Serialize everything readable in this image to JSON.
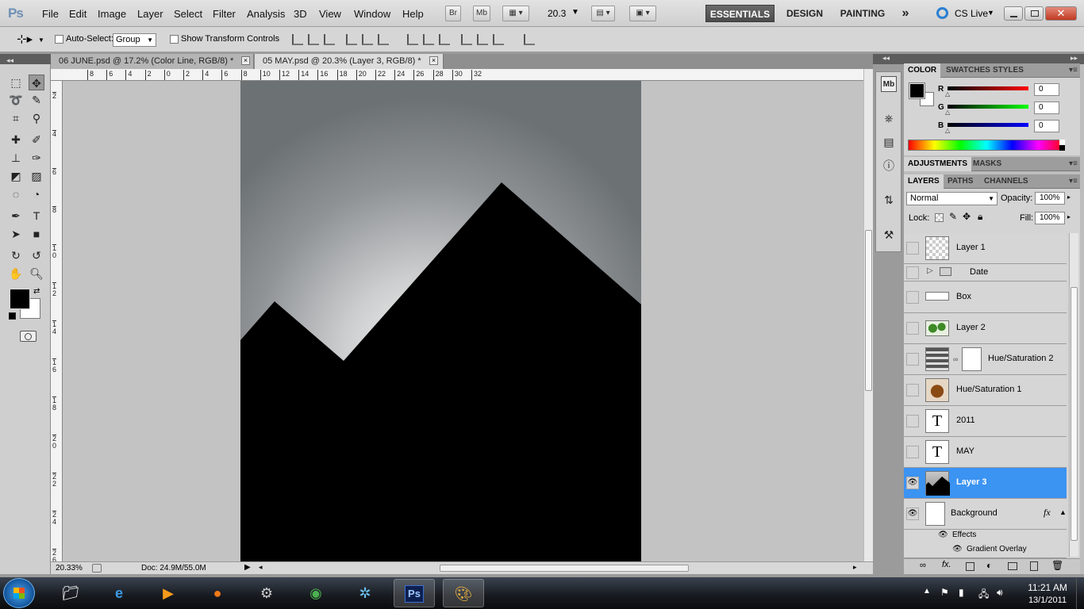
{
  "app": {
    "logo": "Ps"
  },
  "menu": [
    "File",
    "Edit",
    "Image",
    "Layer",
    "Select",
    "Filter",
    "Analysis",
    "3D",
    "View",
    "Window",
    "Help"
  ],
  "appbar": {
    "br": "Br",
    "mb": "Mb",
    "zoom": "20.3"
  },
  "workspaces": {
    "essentials": "ESSENTIALS",
    "design": "DESIGN",
    "painting": "PAINTING",
    "more": "»"
  },
  "cslive": "CS Live",
  "options": {
    "auto_select": "Auto-Select:",
    "auto_select_value": "Group",
    "transform": "Show Transform Controls"
  },
  "tabs": [
    {
      "label": "06 JUNE.psd @ 17.2% (Color Line, RGB/8) *"
    },
    {
      "label": "05 MAY.psd @ 20.3% (Layer 3, RGB/8) *"
    }
  ],
  "ruler_h": [
    "8",
    "6",
    "4",
    "2",
    "0",
    "2",
    "4",
    "6",
    "8",
    "10",
    "12",
    "14",
    "16",
    "18",
    "20",
    "22",
    "24",
    "26",
    "28",
    "30",
    "32"
  ],
  "ruler_v": [
    "2",
    "4",
    "6",
    "8",
    "1\n0",
    "1\n2",
    "1\n4",
    "1\n6",
    "1\n8",
    "2\n0",
    "2\n2",
    "2\n4",
    "2\n6"
  ],
  "status": {
    "zoom": "20.33%",
    "doc": "Doc: 24.9M/55.0M"
  },
  "color_panel": {
    "tabs": [
      "COLOR",
      "SWATCHES",
      "STYLES"
    ],
    "r_label": "R",
    "g_label": "G",
    "b_label": "B",
    "r": "0",
    "g": "0",
    "b": "0"
  },
  "adjust_tabs": [
    "ADJUSTMENTS",
    "MASKS"
  ],
  "layers_panel": {
    "tabs": [
      "LAYERS",
      "PATHS",
      "CHANNELS"
    ],
    "blend": "Normal",
    "opacity_label": "Opacity:",
    "opacity": "100%",
    "lock_label": "Lock:",
    "fill_label": "Fill:",
    "fill": "100%",
    "layers": [
      {
        "name": "Layer 1"
      },
      {
        "name": "Date"
      },
      {
        "name": "Box"
      },
      {
        "name": "Layer 2"
      },
      {
        "name": "Hue/Saturation 2"
      },
      {
        "name": "Hue/Saturation 1"
      },
      {
        "name": "2011"
      },
      {
        "name": "MAY"
      },
      {
        "name": "Layer 3"
      },
      {
        "name": "Background"
      }
    ],
    "text_thumb": "T",
    "fx": "fx",
    "effects": "Effects",
    "gradient_overlay": "Gradient Overlay"
  },
  "taskbar": {
    "time": "11:21 AM",
    "date": "13/1/2011"
  }
}
